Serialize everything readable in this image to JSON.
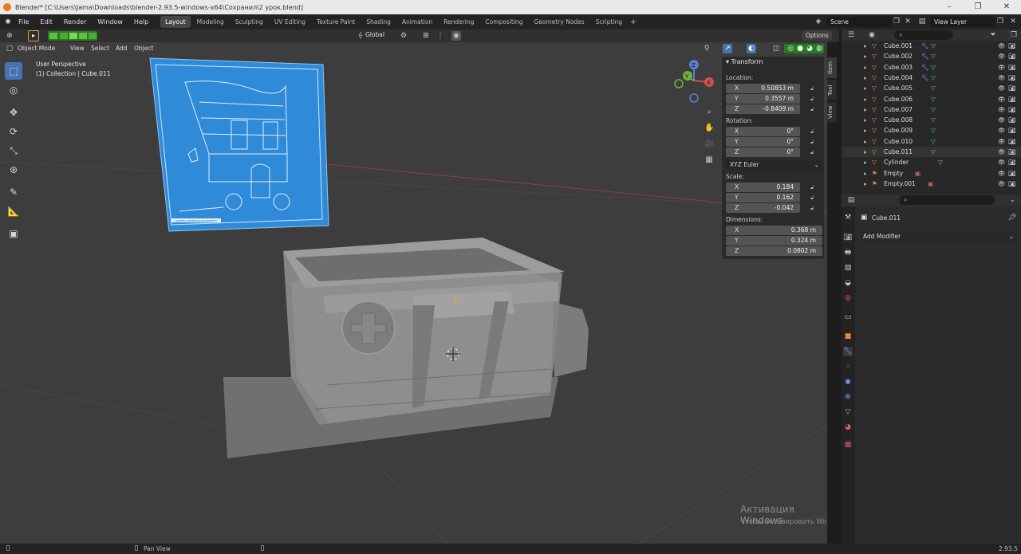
{
  "window": {
    "title": "Blender* [C:\\Users\\Jama\\Downloads\\blender-2.93.5-windows-x64\\Сохранил\\2 урок.blend]"
  },
  "menus": [
    "File",
    "Edit",
    "Render",
    "Window",
    "Help"
  ],
  "workspaces": [
    "Layout",
    "Modeling",
    "Sculpting",
    "UV Editing",
    "Texture Paint",
    "Shading",
    "Animation",
    "Rendering",
    "Compositing",
    "Geometry Nodes",
    "Scripting"
  ],
  "active_workspace": "Layout",
  "scene": "Scene",
  "view_layer": "View Layer",
  "header": {
    "transform_orientation": "Global",
    "options": "Options"
  },
  "viewport_menu": {
    "mode": "Object Mode",
    "items": [
      "View",
      "Select",
      "Add",
      "Object"
    ]
  },
  "viewport_info": {
    "line1": "User Perspective",
    "line2": "(1) Collection | Cube.011"
  },
  "npanel": {
    "title": "Transform",
    "location_label": "Location:",
    "location": [
      {
        "axis": "X",
        "value": "0.50853 m"
      },
      {
        "axis": "Y",
        "value": "0.3557 m"
      },
      {
        "axis": "Z",
        "value": "-0.8409 m"
      }
    ],
    "rotation_label": "Rotation:",
    "rotation": [
      {
        "axis": "X",
        "value": "0°"
      },
      {
        "axis": "Y",
        "value": "0°"
      },
      {
        "axis": "Z",
        "value": "0°"
      }
    ],
    "rotation_mode": "XYZ Euler",
    "scale_label": "Scale:",
    "scale": [
      {
        "axis": "X",
        "value": "0.184"
      },
      {
        "axis": "Y",
        "value": "0.162"
      },
      {
        "axis": "Z",
        "value": "-0.042"
      }
    ],
    "dimensions_label": "Dimensions:",
    "dimensions": [
      {
        "axis": "X",
        "value": "0.368 m"
      },
      {
        "axis": "Y",
        "value": "0.324 m"
      },
      {
        "axis": "Z",
        "value": "0.0802 m"
      }
    ]
  },
  "side_tabs": [
    "Item",
    "Tool",
    "View"
  ],
  "outliner": [
    {
      "name": "Cube.001",
      "type": "mesh"
    },
    {
      "name": "Cube.002",
      "type": "mesh"
    },
    {
      "name": "Cube.003",
      "type": "mesh"
    },
    {
      "name": "Cube.004",
      "type": "mesh"
    },
    {
      "name": "Cube.005",
      "type": "mesh"
    },
    {
      "name": "Cube.006",
      "type": "mesh"
    },
    {
      "name": "Cube.007",
      "type": "mesh"
    },
    {
      "name": "Cube.008",
      "type": "mesh"
    },
    {
      "name": "Cube.009",
      "type": "mesh"
    },
    {
      "name": "Cube.010",
      "type": "mesh"
    },
    {
      "name": "Cube.011",
      "type": "mesh"
    },
    {
      "name": "Cylinder",
      "type": "mesh"
    },
    {
      "name": "Empty",
      "type": "empty"
    },
    {
      "name": "Empty.001",
      "type": "empty"
    }
  ],
  "properties": {
    "object": "Cube.011",
    "add_modifier": "Add Modifier"
  },
  "statusbar": {
    "left": "Pan View",
    "version": "2.93.5"
  },
  "watermark": {
    "title": "Активация Windows",
    "text": "Чтобы активировать Windows, перейдите в раздел \"Параметры\"."
  },
  "blueprint": {
    "caption": "SCREEN CARDBOARD BLUEPRINTS"
  },
  "colors": {
    "accent": "#4772b3",
    "active_green": "#4c8c3f",
    "blueprint": "#2e86d6",
    "viewport": "#3d3d3d"
  }
}
